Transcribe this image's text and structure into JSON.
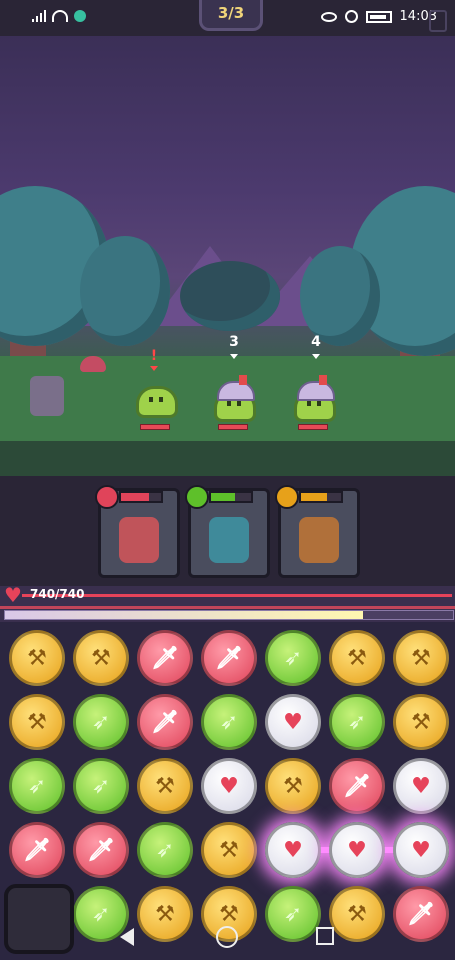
{
  "status_bar": {
    "time": "14:03"
  },
  "wave": {
    "label": "3/3"
  },
  "enemies": [
    {
      "turn": "!",
      "type": "slime"
    },
    {
      "turn": "3",
      "type": "armored-slime"
    },
    {
      "turn": "4",
      "type": "armored-slime"
    }
  ],
  "heroes": [
    {
      "name": "red-warrior",
      "element": "sword",
      "color": "#e0445a",
      "charge": 0.7
    },
    {
      "name": "blue-hooded",
      "element": "spear",
      "color": "#5ec02a",
      "charge": 0.6
    },
    {
      "name": "pirate",
      "element": "axe",
      "color": "#e7a11a",
      "charge": 0.65
    }
  ],
  "player_hp": {
    "text": "740/740",
    "fraction": 1.0
  },
  "energy": {
    "fraction": 0.8
  },
  "board": {
    "rows": [
      [
        "axe",
        "axe",
        "sword",
        "sword",
        "spear",
        "axe",
        "axe"
      ],
      [
        "axe",
        "spear",
        "sword",
        "spear",
        "heart",
        "spear",
        "axe"
      ],
      [
        "spear",
        "spear",
        "axe",
        "heart",
        "axe",
        "sword",
        "heart"
      ],
      [
        "sword",
        "sword",
        "spear",
        "axe",
        "heart",
        "heart",
        "heart"
      ],
      [
        "",
        "spear",
        "axe",
        "axe",
        "spear",
        "axe",
        "sword"
      ]
    ],
    "glow_cells": [
      [
        3,
        4
      ],
      [
        3,
        5
      ],
      [
        3,
        6
      ]
    ]
  },
  "glyphs": {
    "axe": "⚒",
    "sword": "🗡",
    "spear": "➶",
    "heart": "♥"
  }
}
